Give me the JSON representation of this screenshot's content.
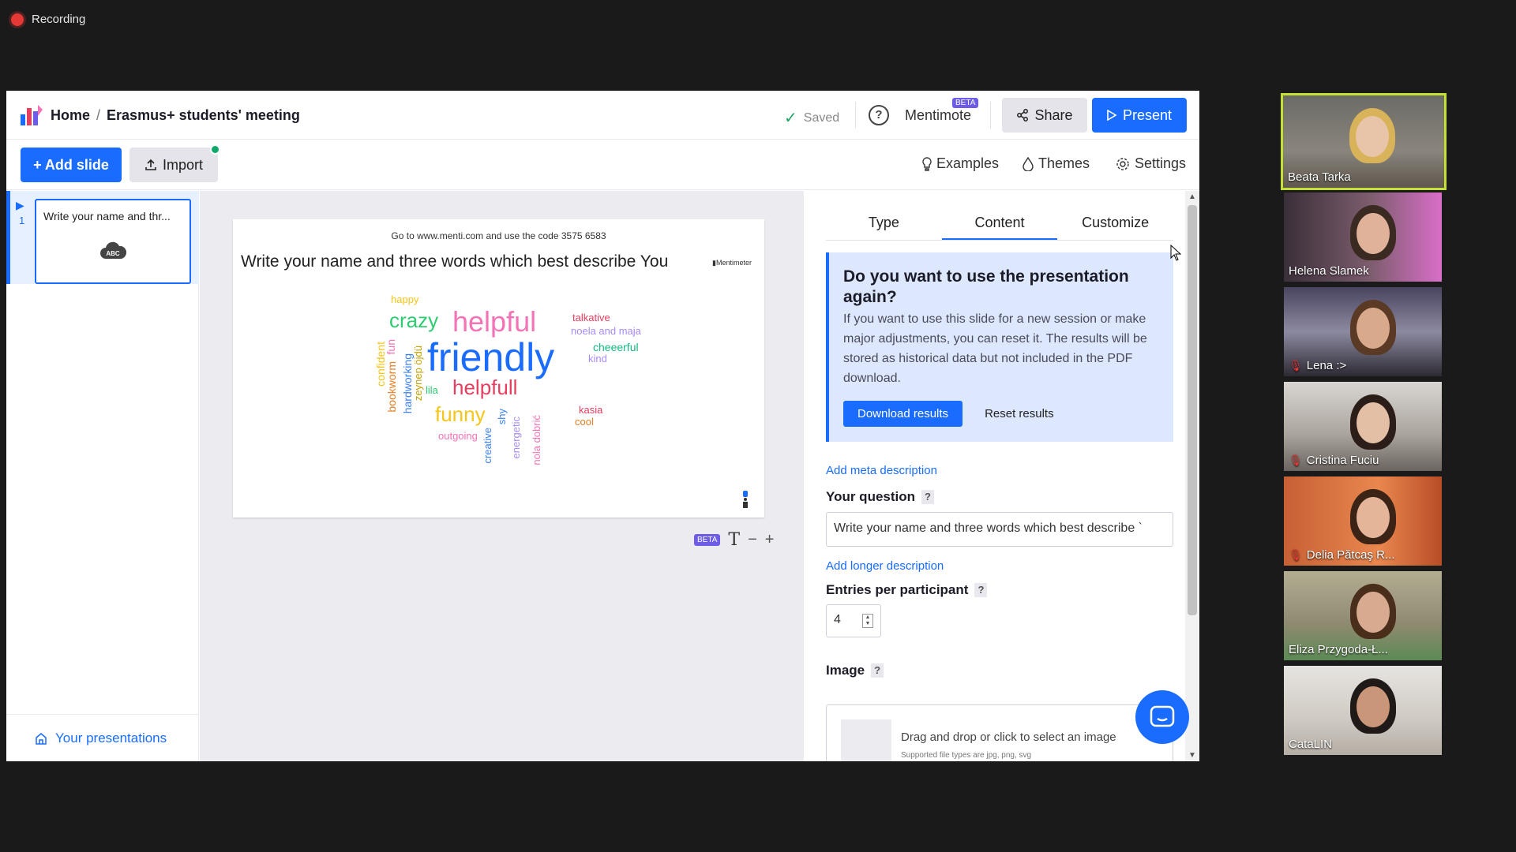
{
  "meeting": {
    "recording_label": "Recording",
    "participants": [
      {
        "name": "Beata Tarka",
        "muted": false,
        "active": true
      },
      {
        "name": "Helena Slamek",
        "muted": false,
        "active": false
      },
      {
        "name": "Lena :>",
        "muted": true,
        "active": false
      },
      {
        "name": "Cristina Fuciu",
        "muted": true,
        "active": false
      },
      {
        "name": "Delia Pătcaş R...",
        "muted": true,
        "active": false
      },
      {
        "name": "Eliza Przygoda-Ł...",
        "muted": false,
        "active": false
      },
      {
        "name": "CataLIN",
        "muted": false,
        "active": false
      }
    ]
  },
  "header": {
    "home": "Home",
    "separator": "/",
    "presentation_title": "Erasmus+ students' meeting",
    "saved_label": "Saved",
    "mentimote_label": "Mentimote",
    "mentimote_badge": "BETA",
    "share_label": "Share",
    "present_label": "Present"
  },
  "toolbar": {
    "add_slide_label": "+ Add slide",
    "import_label": "Import",
    "examples_label": "Examples",
    "themes_label": "Themes",
    "settings_label": "Settings"
  },
  "sidebar": {
    "slides": [
      {
        "number": "1",
        "title": "Write your name and thr...",
        "icon_text": "ABC"
      }
    ],
    "your_presentations_label": "Your presentations"
  },
  "slide": {
    "code_text": "Go to www.menti.com and use the code 3575 6583",
    "title": "Write your name and three words which best describe You",
    "brand": "Mentimeter",
    "words": [
      {
        "text": "happy",
        "color": "#f5c518"
      },
      {
        "text": "crazy",
        "color": "#2ecc71"
      },
      {
        "text": "helpful",
        "color": "#f472b6"
      },
      {
        "text": "talkative",
        "color": "#e53e5f"
      },
      {
        "text": "noela and maja",
        "color": "#a78bfa"
      },
      {
        "text": "fun",
        "color": "#f472b6"
      },
      {
        "text": "friendly",
        "color": "#196cff"
      },
      {
        "text": "cheeerful",
        "color": "#10b981"
      },
      {
        "text": "kind",
        "color": "#a78bfa"
      },
      {
        "text": "confident",
        "color": "#f5c518"
      },
      {
        "text": "bookworm",
        "color": "#e67e22"
      },
      {
        "text": "hardworking",
        "color": "#3b82f6"
      },
      {
        "text": "zeynep öjdü",
        "color": "#c4a000"
      },
      {
        "text": "lila",
        "color": "#2ecc71"
      },
      {
        "text": "helpfull",
        "color": "#e53e5f"
      },
      {
        "text": "funny",
        "color": "#f5c518"
      },
      {
        "text": "shy",
        "color": "#3b82f6"
      },
      {
        "text": "kasia",
        "color": "#e53e5f"
      },
      {
        "text": "cool",
        "color": "#e67e22"
      },
      {
        "text": "outgoing",
        "color": "#f472b6"
      },
      {
        "text": "creative",
        "color": "#3b82f6"
      },
      {
        "text": "energetic",
        "color": "#a78bfa"
      },
      {
        "text": "nola dobrić",
        "color": "#f472b6"
      }
    ],
    "zoom_badge": "BETA",
    "zoom_t": "T",
    "zoom_minus": "−",
    "zoom_plus": "+"
  },
  "panel": {
    "tabs": [
      "Type",
      "Content",
      "Customize"
    ],
    "active_tab": "Content",
    "info_title": "Do you want to use the presentation again?",
    "info_text": "If you want to use this slide for a new session or make major adjustments, you can reset it. The results will be stored as historical data but not included in the PDF download.",
    "download_results_label": "Download results",
    "reset_results_label": "Reset results",
    "add_meta_label": "Add meta description",
    "question_label": "Your question",
    "question_value": "Write your name and three words which best describe `",
    "add_longer_label": "Add longer description",
    "entries_label": "Entries per participant",
    "entries_value": "4",
    "image_label": "Image",
    "image_drop_text": "Drag and drop or click to select an image",
    "image_supported": "Supported file types are jpg, png, svg",
    "help_mark": "?"
  },
  "colors": {
    "accent": "#196cff",
    "beta": "#6c5ce7",
    "active_speaker": "#c4e034"
  }
}
